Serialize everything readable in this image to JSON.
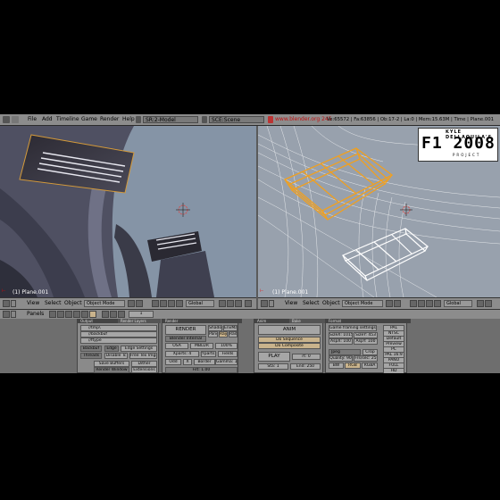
{
  "menubar": {
    "items": [
      "File",
      "Add",
      "Timeline",
      "Game",
      "Render",
      "Help"
    ],
    "screen_field": "SR:2-Model",
    "scene_field": "SCE:Scene",
    "link": "www.blender.org 245",
    "stats": "Ve:65572 | Fa:63856 | Ob:17-2 | La:0 | Mem:15.63M | Time | Plane.001"
  },
  "viewport_left": {
    "label": "(1) Plane.001"
  },
  "viewport_right": {
    "label": "(1) Plane.001"
  },
  "logo": {
    "line1": "KYLE DELLAQUILA'S",
    "line2": "F1 2008",
    "line3": "PROJECT"
  },
  "header_left": {
    "view": "View",
    "select": "Select",
    "object": "Object",
    "mode": "Object Mode",
    "orientation": "Global"
  },
  "header_right": {
    "view": "View",
    "select": "Select",
    "object": "Object",
    "mode": "Object Mode",
    "orientation": "Global"
  },
  "panelbar": {
    "label": "Panels",
    "frame": "1"
  },
  "panels": {
    "output_tab": "Output",
    "render_layers_tab": "Render Layers",
    "output_rows": [
      "//tmp\\",
      "//backbuf",
      "//ftype"
    ],
    "output_buttons": [
      "Backbuf",
      "Edge",
      "Edge Settings",
      "Threads",
      "Disable Tc",
      "Free Tex Imgs",
      "Save Buffers",
      "Dither",
      "Render Window",
      "Extensions"
    ],
    "render_tab": "Render",
    "render_button": "RENDER",
    "render_buttons": [
      "Shadow",
      "EnvMap",
      "Pano",
      "Ray",
      "Radio",
      "Blender Internal",
      "OSA",
      "MBLUR",
      "100%",
      "Xparts: 4",
      "Yparts: 4",
      "Fields",
      "Odd",
      "X",
      "Border",
      "Gamma: 1.00",
      "Filt: 1.00"
    ],
    "anim_tab": "Anim",
    "anim_button": "ANIM",
    "do_sequence": "Do Sequence",
    "do_composite": "Do Composite",
    "play_button": "PLAY",
    "rt": "rt: 0",
    "sta": "Sta: 1",
    "end": "End: 250",
    "bake_tab": "Bake",
    "format_tab": "Format",
    "format_title": "Game framing settings",
    "sizex": "SizeX: 1015",
    "sizey": "SizeY: 453",
    "aspx": "AspX: 100",
    "aspy": "AspY: 100",
    "jpeg": "Jpeg",
    "crop": "Crop",
    "quality": "Quality: 90",
    "frs": "Frs/sec: 25",
    "bw": "BW",
    "rgb": "RGB",
    "rgba": "RGBA",
    "presets": [
      "PAL",
      "NTSC",
      "Default",
      "Preview",
      "PC",
      "PAL 16:9",
      "PANO",
      "FULL",
      "HD"
    ]
  }
}
